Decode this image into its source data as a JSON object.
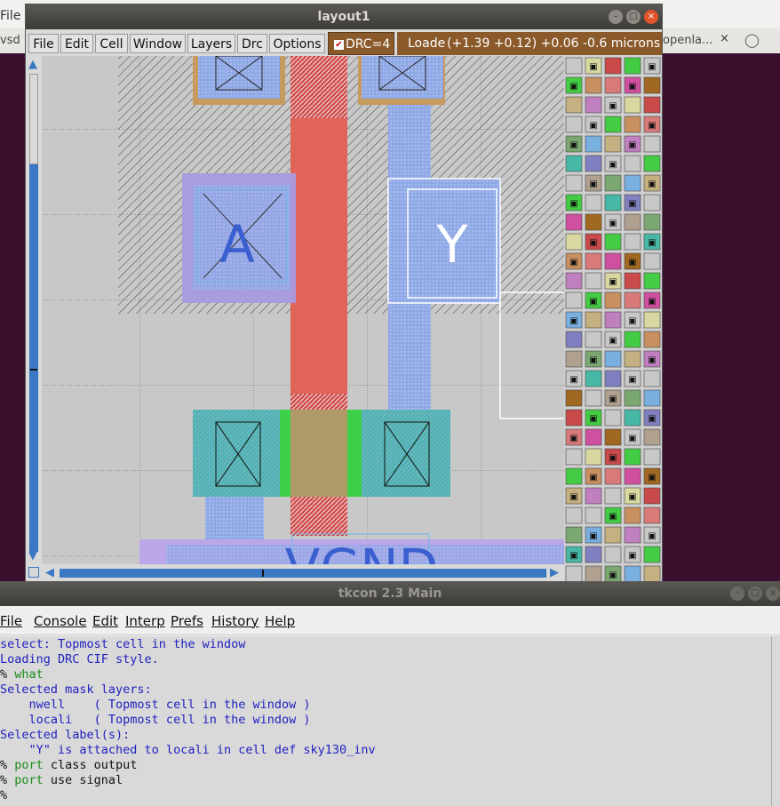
{
  "desktop": {
    "bg_app_menu": "File",
    "bg_tab_left": "vsd",
    "bg_tab_right": "openla...",
    "bg_tab_close": "×"
  },
  "magic_window": {
    "title": "layout1",
    "menu": [
      "File",
      "Edit",
      "Cell",
      "Window",
      "Layers",
      "Drc",
      "Options"
    ],
    "drc_label": "DRC=4",
    "drc_checked": true,
    "status_loaded": "Loaded",
    "status_coords": "(+1.39 +0.12) +0.06 -0.6 microns",
    "labels": {
      "input_a": "A",
      "output_y": "Y",
      "ground": "VGND"
    },
    "colors": {
      "poly": "#e0645a",
      "locali": "#8fa8e6",
      "diff": "#3fbfa6",
      "nwell_hatch": "#333333",
      "statusbar": "#8b5a2b",
      "scrollbar": "#3b78c3"
    }
  },
  "tkcon": {
    "title": "tkcon 2.3 Main",
    "menu": [
      "File",
      "Console",
      "Edit",
      "Interp",
      "Prefs",
      "History",
      "Help"
    ],
    "lines": [
      {
        "text": "select: Topmost cell in the window",
        "style": "blue"
      },
      {
        "text": "Loading DRC CIF style.",
        "style": "blue"
      },
      {
        "prompt": "% ",
        "cmd": "what",
        "style": "green"
      },
      {
        "text": "Selected mask layers:",
        "style": "blue"
      },
      {
        "text": "    nwell    ( Topmost cell in the window )",
        "style": "blue"
      },
      {
        "text": "    locali   ( Topmost cell in the window )",
        "style": "blue"
      },
      {
        "text": "Selected label(s):",
        "style": "blue"
      },
      {
        "text": "    \"Y\" is attached to locali in cell def sky130_inv",
        "style": "blue"
      },
      {
        "prompt": "% ",
        "cmd": "port",
        "args": " class output",
        "style": "green"
      },
      {
        "prompt": "% ",
        "cmd": "port",
        "args": " use signal",
        "style": "green"
      },
      {
        "prompt": "% ",
        "cmd": "",
        "args": "",
        "style": "green"
      }
    ]
  }
}
